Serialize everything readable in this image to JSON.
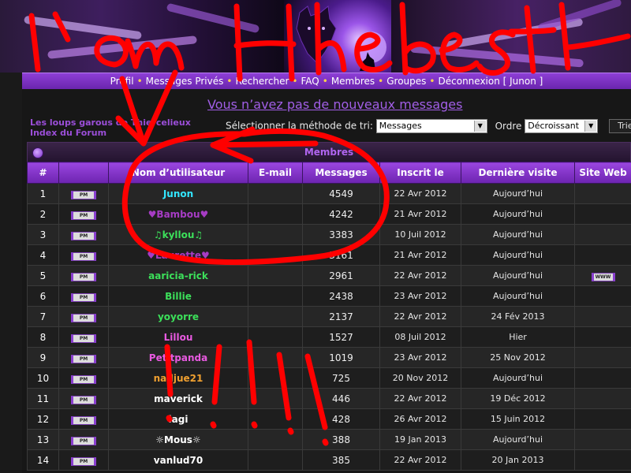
{
  "nav": {
    "items": [
      "Profil",
      "Messages Privés",
      "Rechercher",
      "FAQ",
      "Membres",
      "Groupes",
      "Déconnexion [ Junon ]"
    ]
  },
  "messages_notice": "Vous n’avez pas de nouveaux messages",
  "side_links": {
    "forum_name": "Les loups garous de Thiercelieux",
    "index": "Index du Forum"
  },
  "sort": {
    "method_label": "Sélectionner la méthode de tri:",
    "method_value": "Messages",
    "order_label": "Ordre",
    "order_value": "Décroissant",
    "button": "Trier"
  },
  "members": {
    "title": "Membres",
    "columns": [
      "#",
      "",
      "Nom d’utilisateur",
      "E-mail",
      "Messages",
      "Inscrit le",
      "Dernière visite",
      "Site Web"
    ],
    "pm_label": "PM",
    "www_label": "WWW",
    "rows": [
      {
        "num": "1",
        "name": "Junon",
        "color": "#33e6ff",
        "messages": "4549",
        "joined": "22 Avr 2012",
        "last": "Aujourd’hui",
        "www": false
      },
      {
        "num": "2",
        "name": "♥Bambou♥",
        "color": "#a63cc4",
        "messages": "4242",
        "joined": "21 Avr 2012",
        "last": "Aujourd’hui",
        "www": false
      },
      {
        "num": "3",
        "name": "♫kyllou♫",
        "color": "#3ce05a",
        "messages": "3383",
        "joined": "10 Juil 2012",
        "last": "Aujourd’hui",
        "www": false
      },
      {
        "num": "4",
        "name": "♥Laurette♥",
        "color": "#a63cc4",
        "messages": "3161",
        "joined": "21 Avr 2012",
        "last": "Aujourd’hui",
        "www": false
      },
      {
        "num": "5",
        "name": "aaricia-rick",
        "color": "#3ce05a",
        "messages": "2961",
        "joined": "22 Avr 2012",
        "last": "Aujourd’hui",
        "www": true
      },
      {
        "num": "6",
        "name": "Billie",
        "color": "#3ce05a",
        "messages": "2438",
        "joined": "23 Avr 2012",
        "last": "Aujourd’hui",
        "www": false
      },
      {
        "num": "7",
        "name": "yoyorre",
        "color": "#3ce05a",
        "messages": "2137",
        "joined": "22 Avr 2012",
        "last": "24 Fév 2013",
        "www": false
      },
      {
        "num": "8",
        "name": "Lillou",
        "color": "#e85ae0",
        "messages": "1527",
        "joined": "08 Juil 2012",
        "last": "Hier",
        "www": false
      },
      {
        "num": "9",
        "name": "Petitpanda",
        "color": "#e85ae0",
        "messages": "1019",
        "joined": "23 Avr 2012",
        "last": "25 Nov 2012",
        "www": false
      },
      {
        "num": "10",
        "name": "nadjue21",
        "color": "#f0a030",
        "messages": "725",
        "joined": "20 Nov 2012",
        "last": "Aujourd’hui",
        "www": false
      },
      {
        "num": "11",
        "name": "maverick",
        "color": "#ffffff",
        "messages": "446",
        "joined": "22 Avr 2012",
        "last": "19 Déc 2012",
        "www": false
      },
      {
        "num": "12",
        "name": "lagi",
        "color": "#ffffff",
        "messages": "428",
        "joined": "26 Avr 2012",
        "last": "15 Juin 2012",
        "www": false
      },
      {
        "num": "13",
        "name": "☼Mous☼",
        "color": "#ffffff",
        "messages": "388",
        "joined": "19 Jan 2013",
        "last": "Aujourd’hui",
        "www": false
      },
      {
        "num": "14",
        "name": "vanlud70",
        "color": "#ffffff",
        "messages": "385",
        "joined": "22 Avr 2012",
        "last": "20 Jan 2013",
        "www": false
      }
    ]
  },
  "annotation": {
    "text": "i'am the best",
    "color": "#ff0000"
  }
}
